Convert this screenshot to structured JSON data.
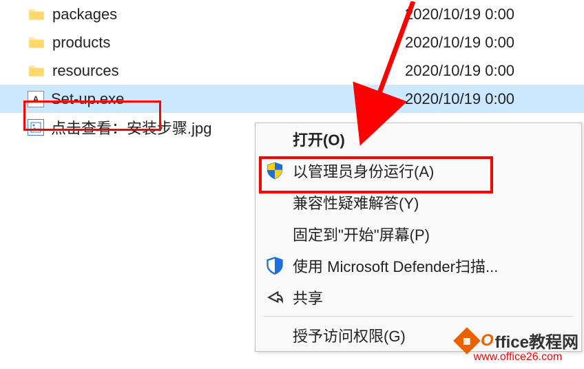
{
  "files": {
    "packages": {
      "name": "packages",
      "date": "2020/10/19 0:00"
    },
    "products": {
      "name": "products",
      "date": "2020/10/19 0:00"
    },
    "resources": {
      "name": "resources",
      "date": "2020/10/19 0:00"
    },
    "setup": {
      "name": "Set-up.exe",
      "date": "2020/10/19 0:00"
    },
    "guide": {
      "name": "点击查看：安装步骤.jpg",
      "date": ""
    }
  },
  "menu": {
    "open": "打开(O)",
    "run_admin": "以管理员身份运行(A)",
    "compat": "兼容性疑难解答(Y)",
    "pin_start": "固定到\"开始\"屏幕(P)",
    "defender": "使用 Microsoft Defender扫描...",
    "share": "共享",
    "grant_access": "授予访问权限(G)"
  },
  "watermark": {
    "brand_prefix": "O",
    "brand_rest": "ffice教程网",
    "url": "www.office26.com"
  }
}
